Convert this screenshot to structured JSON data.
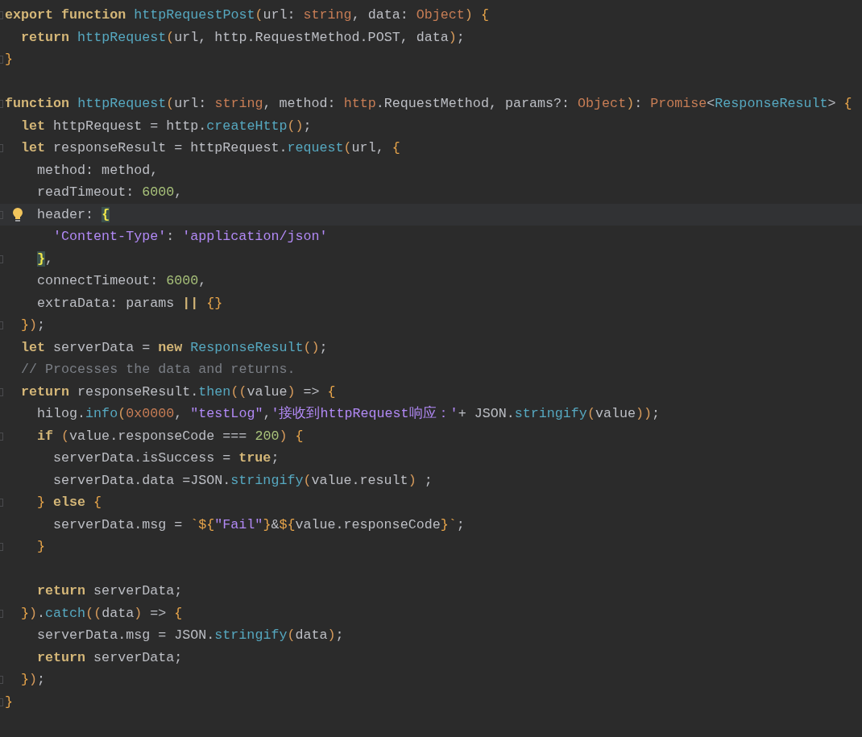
{
  "editor": {
    "lines": [
      {
        "fold": true,
        "tokens": [
          {
            "kind": "kw",
            "text": "export function "
          },
          {
            "kind": "fn",
            "text": "httpRequestPost"
          },
          {
            "kind": "paren",
            "text": "("
          },
          {
            "kind": "text",
            "text": "url: "
          },
          {
            "kind": "type",
            "text": "string"
          },
          {
            "kind": "text",
            "text": ", data: "
          },
          {
            "kind": "type",
            "text": "Object"
          },
          {
            "kind": "paren",
            "text": ") "
          },
          {
            "kind": "brace",
            "text": "{"
          }
        ],
        "children": [
          {
            "fold": false,
            "tokens": [
              {
                "kind": "kw",
                "text": "return "
              },
              {
                "kind": "fn",
                "text": "httpRequest"
              },
              {
                "kind": "paren",
                "text": "("
              },
              {
                "kind": "text",
                "text": "url, http.RequestMethod.POST, data"
              },
              {
                "kind": "paren",
                "text": ")"
              },
              {
                "kind": "text",
                "text": ";"
              }
            ]
          }
        ]
      },
      {
        "fold": true,
        "tokens": [
          {
            "kind": "brace",
            "text": "}"
          }
        ]
      },
      {
        "fold": false
      },
      {
        "fold": true,
        "tokens": [
          {
            "kind": "kw",
            "text": "function "
          },
          {
            "kind": "fn",
            "text": "httpRequest"
          },
          {
            "kind": "paren",
            "text": "("
          },
          {
            "kind": "text",
            "text": "url: "
          },
          {
            "kind": "type",
            "text": "string"
          },
          {
            "kind": "text",
            "text": ", method: "
          },
          {
            "kind": "type",
            "text": "http"
          },
          {
            "kind": "text",
            "text": ".RequestMethod, params?: "
          },
          {
            "kind": "type",
            "text": "Object"
          },
          {
            "kind": "paren",
            "text": ")"
          },
          {
            "kind": "text",
            "text": ": "
          },
          {
            "kind": "type",
            "text": "Promise"
          },
          {
            "kind": "text",
            "text": "<"
          },
          {
            "kind": "fn",
            "text": "ResponseResult"
          },
          {
            "kind": "text",
            "text": "> "
          },
          {
            "kind": "brace",
            "text": "{"
          }
        ],
        "children": [
          {
            "fold": false,
            "tokens": [
              {
                "kind": "kw",
                "text": "let "
              },
              {
                "kind": "text",
                "text": "httpRequest = http."
              },
              {
                "kind": "fn",
                "text": "createHttp"
              },
              {
                "kind": "paren",
                "text": "()"
              },
              {
                "kind": "text",
                "text": ";"
              }
            ]
          },
          {
            "fold": true,
            "tokens": [
              {
                "kind": "kw",
                "text": "let "
              },
              {
                "kind": "text",
                "text": "responseResult = httpRequest."
              },
              {
                "kind": "fn",
                "text": "request"
              },
              {
                "kind": "paren",
                "text": "("
              },
              {
                "kind": "text",
                "text": "url, "
              },
              {
                "kind": "brace",
                "text": "{"
              }
            ],
            "children": [
              {
                "fold": false,
                "tokens": [
                  {
                    "kind": "text",
                    "text": "method: method,"
                  }
                ]
              },
              {
                "fold": false,
                "tokens": [
                  {
                    "kind": "text",
                    "text": "readTimeout: "
                  },
                  {
                    "kind": "num",
                    "text": "6000"
                  },
                  {
                    "kind": "text",
                    "text": ","
                  }
                ]
              },
              {
                "fold": true,
                "current": true,
                "hint": true,
                "tokens": [
                  {
                    "kind": "text",
                    "text": "header: "
                  },
                  {
                    "kind": "match",
                    "text": "{"
                  }
                ],
                "children": [
                  {
                    "fold": false,
                    "tokens": [
                      {
                        "kind": "str",
                        "text": "'Content-Type'"
                      },
                      {
                        "kind": "text",
                        "text": ": "
                      },
                      {
                        "kind": "str",
                        "text": "'application/json'"
                      }
                    ]
                  }
                ]
              },
              {
                "fold": true,
                "tokens": [
                  {
                    "kind": "match",
                    "text": "}"
                  },
                  {
                    "kind": "text",
                    "text": ","
                  }
                ]
              },
              {
                "fold": false,
                "tokens": [
                  {
                    "kind": "text",
                    "text": "connectTimeout: "
                  },
                  {
                    "kind": "num",
                    "text": "6000"
                  },
                  {
                    "kind": "text",
                    "text": ","
                  }
                ]
              },
              {
                "fold": false,
                "tokens": [
                  {
                    "kind": "text",
                    "text": "extraData: params "
                  },
                  {
                    "kind": "kw",
                    "text": "|| "
                  },
                  {
                    "kind": "brace",
                    "text": "{}"
                  }
                ]
              }
            ]
          },
          {
            "fold": true,
            "tokens": [
              {
                "kind": "brace",
                "text": "}"
              },
              {
                "kind": "paren",
                "text": ")"
              },
              {
                "kind": "text",
                "text": ";"
              }
            ]
          },
          {
            "fold": false,
            "tokens": [
              {
                "kind": "kw",
                "text": "let "
              },
              {
                "kind": "text",
                "text": "serverData = "
              },
              {
                "kind": "kw",
                "text": "new "
              },
              {
                "kind": "fn",
                "text": "ResponseResult"
              },
              {
                "kind": "paren",
                "text": "()"
              },
              {
                "kind": "text",
                "text": ";"
              }
            ]
          },
          {
            "fold": false,
            "tokens": [
              {
                "kind": "comment",
                "text": "// Processes the data and returns."
              }
            ]
          },
          {
            "fold": true,
            "tokens": [
              {
                "kind": "kw",
                "text": "return "
              },
              {
                "kind": "text",
                "text": "responseResult."
              },
              {
                "kind": "fn",
                "text": "then"
              },
              {
                "kind": "paren",
                "text": "(("
              },
              {
                "kind": "text",
                "text": "value"
              },
              {
                "kind": "paren",
                "text": ")"
              },
              {
                "kind": "text",
                "text": " => "
              },
              {
                "kind": "brace",
                "text": "{"
              }
            ],
            "children": [
              {
                "fold": false,
                "tokens": [
                  {
                    "kind": "text",
                    "text": "hilog."
                  },
                  {
                    "kind": "fn",
                    "text": "info"
                  },
                  {
                    "kind": "paren",
                    "text": "("
                  },
                  {
                    "kind": "num2",
                    "text": "0x0000"
                  },
                  {
                    "kind": "text",
                    "text": ", "
                  },
                  {
                    "kind": "str",
                    "text": "\"testLog\""
                  },
                  {
                    "kind": "text",
                    "text": ","
                  },
                  {
                    "kind": "str",
                    "text": "'接收到httpRequest响应：'"
                  },
                  {
                    "kind": "text",
                    "text": "+ JSON."
                  },
                  {
                    "kind": "fn",
                    "text": "stringify"
                  },
                  {
                    "kind": "paren",
                    "text": "("
                  },
                  {
                    "kind": "text",
                    "text": "value"
                  },
                  {
                    "kind": "paren",
                    "text": "))"
                  },
                  {
                    "kind": "text",
                    "text": ";"
                  }
                ]
              },
              {
                "fold": true,
                "tokens": [
                  {
                    "kind": "kw",
                    "text": "if "
                  },
                  {
                    "kind": "paren",
                    "text": "("
                  },
                  {
                    "kind": "text",
                    "text": "value.responseCode === "
                  },
                  {
                    "kind": "num",
                    "text": "200"
                  },
                  {
                    "kind": "paren",
                    "text": ") "
                  },
                  {
                    "kind": "brace",
                    "text": "{"
                  }
                ],
                "children": [
                  {
                    "fold": false,
                    "tokens": [
                      {
                        "kind": "text",
                        "text": "serverData.isSuccess = "
                      },
                      {
                        "kind": "kw",
                        "text": "true"
                      },
                      {
                        "kind": "text",
                        "text": ";"
                      }
                    ]
                  },
                  {
                    "fold": false,
                    "tokens": [
                      {
                        "kind": "text",
                        "text": "serverData.data =JSON."
                      },
                      {
                        "kind": "fn",
                        "text": "stringify"
                      },
                      {
                        "kind": "paren",
                        "text": "("
                      },
                      {
                        "kind": "text",
                        "text": "value.result"
                      },
                      {
                        "kind": "paren",
                        "text": ")"
                      },
                      {
                        "kind": "text",
                        "text": " ;"
                      }
                    ]
                  }
                ]
              },
              {
                "fold": true,
                "tokens": [
                  {
                    "kind": "brace",
                    "text": "} "
                  },
                  {
                    "kind": "kw",
                    "text": "else "
                  },
                  {
                    "kind": "brace",
                    "text": "{"
                  }
                ],
                "children": [
                  {
                    "fold": false,
                    "tokens": [
                      {
                        "kind": "text",
                        "text": "serverData.msg = "
                      },
                      {
                        "kind": "brace",
                        "text": "`${"
                      },
                      {
                        "kind": "str",
                        "text": "\"Fail\""
                      },
                      {
                        "kind": "brace",
                        "text": "}"
                      },
                      {
                        "kind": "text",
                        "text": "&"
                      },
                      {
                        "kind": "brace",
                        "text": "${"
                      },
                      {
                        "kind": "text",
                        "text": "value.responseCode"
                      },
                      {
                        "kind": "brace",
                        "text": "}`"
                      },
                      {
                        "kind": "text",
                        "text": ";"
                      }
                    ]
                  }
                ]
              },
              {
                "fold": true,
                "tokens": [
                  {
                    "kind": "brace",
                    "text": "}"
                  }
                ]
              },
              {
                "fold": false
              },
              {
                "fold": false,
                "tokens": [
                  {
                    "kind": "kw",
                    "text": "return "
                  },
                  {
                    "kind": "text",
                    "text": "serverData;"
                  }
                ]
              }
            ]
          },
          {
            "fold": true,
            "tokens": [
              {
                "kind": "brace",
                "text": "}"
              },
              {
                "kind": "paren",
                "text": ")"
              },
              {
                "kind": "text",
                "text": "."
              },
              {
                "kind": "fn",
                "text": "catch"
              },
              {
                "kind": "paren",
                "text": "(("
              },
              {
                "kind": "text",
                "text": "data"
              },
              {
                "kind": "paren",
                "text": ")"
              },
              {
                "kind": "text",
                "text": " => "
              },
              {
                "kind": "brace",
                "text": "{"
              }
            ],
            "children": [
              {
                "fold": false,
                "tokens": [
                  {
                    "kind": "text",
                    "text": "serverData.msg = JSON."
                  },
                  {
                    "kind": "fn",
                    "text": "stringify"
                  },
                  {
                    "kind": "paren",
                    "text": "("
                  },
                  {
                    "kind": "text",
                    "text": "data"
                  },
                  {
                    "kind": "paren",
                    "text": ")"
                  },
                  {
                    "kind": "text",
                    "text": ";"
                  }
                ]
              },
              {
                "fold": false,
                "tokens": [
                  {
                    "kind": "kw",
                    "text": "return "
                  },
                  {
                    "kind": "text",
                    "text": "serverData;"
                  }
                ]
              }
            ]
          },
          {
            "fold": true,
            "tokens": [
              {
                "kind": "brace",
                "text": "}"
              },
              {
                "kind": "paren",
                "text": ")"
              },
              {
                "kind": "text",
                "text": ";"
              }
            ]
          }
        ]
      },
      {
        "fold": true,
        "tokens": [
          {
            "kind": "brace",
            "text": "}"
          }
        ]
      }
    ]
  }
}
